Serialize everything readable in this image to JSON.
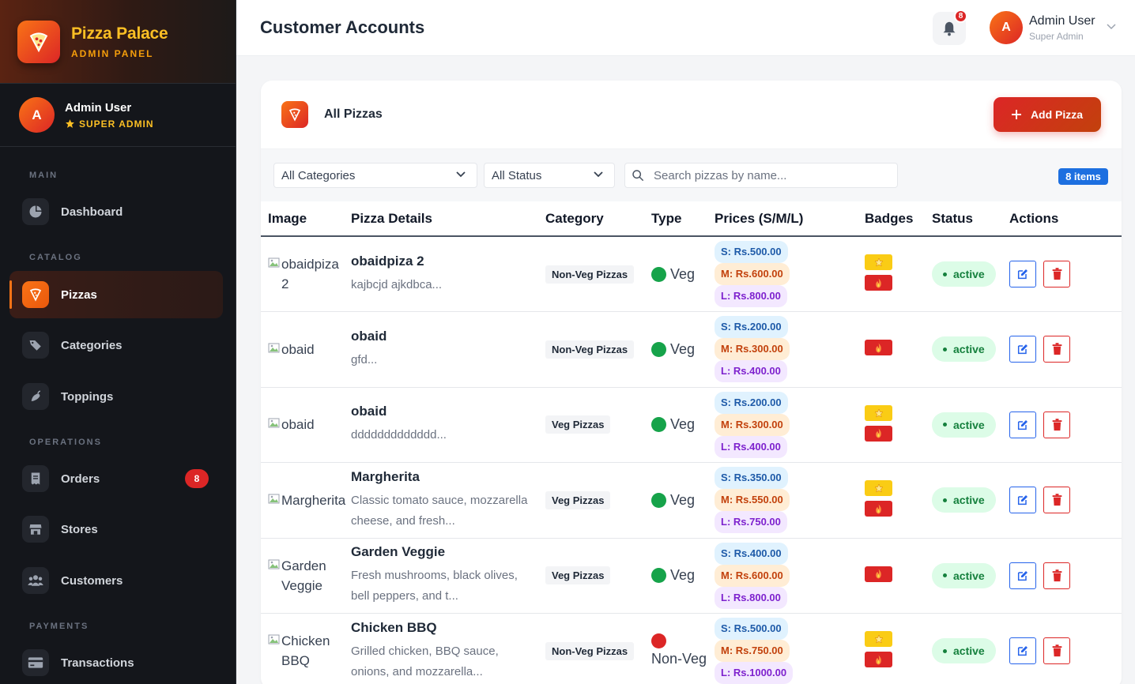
{
  "brand": {
    "name": "Pizza Palace",
    "subtitle": "ADMIN PANEL"
  },
  "sidebar_profile": {
    "avatar_initial": "A",
    "name": "Admin User",
    "role": "SUPER ADMIN"
  },
  "nav": {
    "main_label": "MAIN",
    "catalog_label": "CATALOG",
    "operations_label": "OPERATIONS",
    "payments_label": "PAYMENTS",
    "items": [
      {
        "label": "Dashboard",
        "icon": "pie-chart-icon"
      },
      {
        "label": "Pizzas",
        "icon": "pizza-icon",
        "active": true
      },
      {
        "label": "Categories",
        "icon": "tags-icon"
      },
      {
        "label": "Toppings",
        "icon": "pepper-icon"
      },
      {
        "label": "Orders",
        "icon": "receipt-icon",
        "badge": "8"
      },
      {
        "label": "Stores",
        "icon": "store-icon"
      },
      {
        "label": "Customers",
        "icon": "users-icon"
      },
      {
        "label": "Transactions",
        "icon": "credit-card-icon"
      }
    ]
  },
  "topbar": {
    "title": "Customer Accounts",
    "notification_count": "8",
    "user_initial": "A",
    "user_name": "Admin User",
    "user_role": "Super Admin"
  },
  "card": {
    "title": "All Pizzas",
    "add_button": "Add Pizza"
  },
  "filters": {
    "category_selected": "All Categories",
    "status_selected": "All Status",
    "search_placeholder": "Search pizzas by name...",
    "count_badge": "8 items"
  },
  "table": {
    "headers": [
      "Image",
      "Pizza Details",
      "Category",
      "Type",
      "Prices (S/M/L)",
      "Badges",
      "Status",
      "Actions"
    ],
    "rows": [
      {
        "image_alt": "obaidpiza 2",
        "name": "obaidpiza 2",
        "desc": "kajbcjd ajkdbca...",
        "category": "Non-Veg Pizzas",
        "type": "Veg",
        "price_s": "S: Rs.500.00",
        "price_m": "M: Rs.600.00",
        "price_l": "L: Rs.800.00",
        "badges": [
          "star",
          "fire"
        ],
        "status": "active"
      },
      {
        "image_alt": "obaid",
        "name": "obaid",
        "desc": "gfd...",
        "category": "Non-Veg Pizzas",
        "type": "Veg",
        "price_s": "S: Rs.200.00",
        "price_m": "M: Rs.300.00",
        "price_l": "L: Rs.400.00",
        "badges": [
          "fire"
        ],
        "status": "active"
      },
      {
        "image_alt": "obaid",
        "name": "obaid",
        "desc": "ddddddddddddd...",
        "category": "Veg Pizzas",
        "type": "Veg",
        "price_s": "S: Rs.200.00",
        "price_m": "M: Rs.300.00",
        "price_l": "L: Rs.400.00",
        "badges": [
          "star",
          "fire"
        ],
        "status": "active"
      },
      {
        "image_alt": "Margherita",
        "name": "Margherita",
        "desc": "Classic tomato sauce, mozzarella cheese, and fresh...",
        "category": "Veg Pizzas",
        "type": "Veg",
        "price_s": "S: Rs.350.00",
        "price_m": "M: Rs.550.00",
        "price_l": "L: Rs.750.00",
        "badges": [
          "star",
          "fire"
        ],
        "status": "active"
      },
      {
        "image_alt": "Garden Veggie",
        "name": "Garden Veggie",
        "desc": "Fresh mushrooms, black olives, bell peppers, and t...",
        "category": "Veg Pizzas",
        "type": "Veg",
        "price_s": "S: Rs.400.00",
        "price_m": "M: Rs.600.00",
        "price_l": "L: Rs.800.00",
        "badges": [
          "fire"
        ],
        "status": "active"
      },
      {
        "image_alt": "Chicken BBQ",
        "name": "Chicken BBQ",
        "desc": "Grilled chicken, BBQ sauce, onions, and mozzarella...",
        "category": "Non-Veg Pizzas",
        "type": "Non-Veg",
        "price_s": "S: Rs.500.00",
        "price_m": "M: Rs.750.00",
        "price_l": "L: Rs.1000.00",
        "badges": [
          "star",
          "fire"
        ],
        "status": "active"
      }
    ]
  },
  "colors": {
    "accent": "#f97316",
    "danger": "#dc2626",
    "primary": "#2563eb",
    "sidebar_bg": "#14161b",
    "veg": "#16a34a"
  }
}
